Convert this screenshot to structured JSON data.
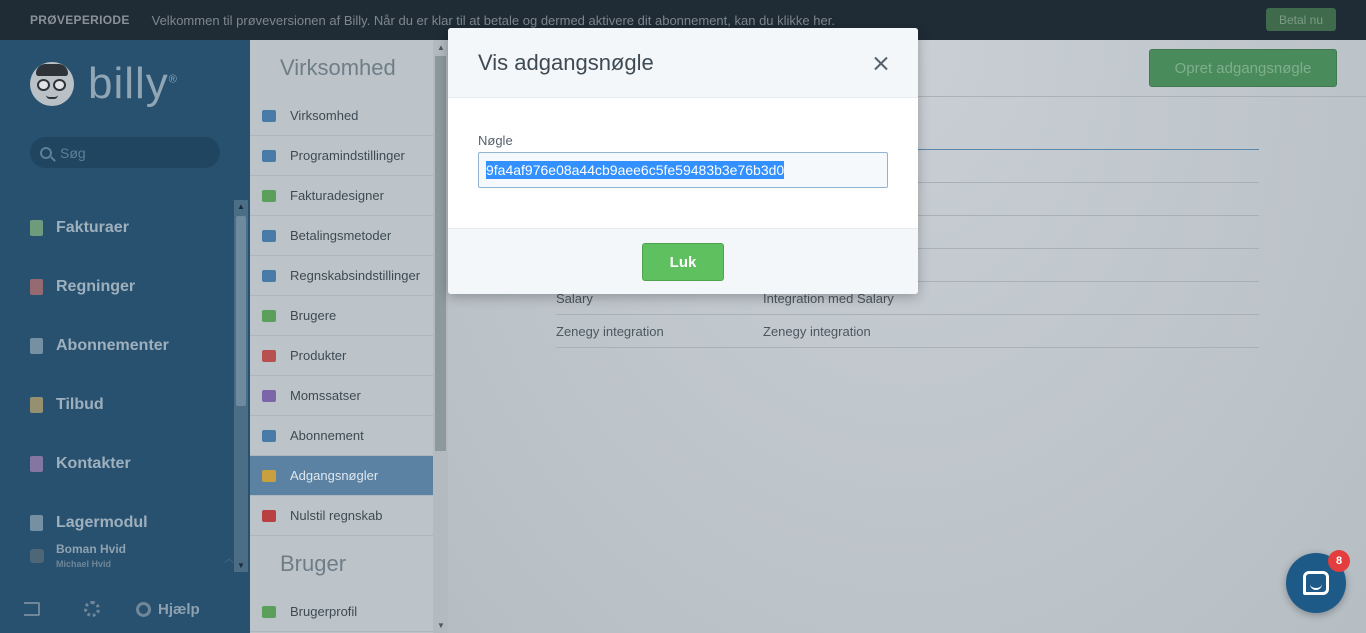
{
  "trial_bar": {
    "label": "PRØVEPERIODE",
    "text": "Velkommen til prøveversionen af Billy. Når du er klar til at betale og dermed aktivere dit abonnement, kan du klikke her.",
    "pay_button": "Betal nu"
  },
  "sidebar": {
    "logo_text": "billy",
    "logo_mark": "®",
    "search_placeholder": "Søg",
    "items": [
      {
        "label": "Fakturaer",
        "icon": "invoice-icon",
        "color": "#7fae7f"
      },
      {
        "label": "Regninger",
        "icon": "bill-icon",
        "color": "#b07070"
      },
      {
        "label": "Abonnementer",
        "icon": "subscription-icon",
        "color": "#8aa0b0"
      },
      {
        "label": "Tilbud",
        "icon": "quote-icon",
        "color": "#b0a070"
      },
      {
        "label": "Kontakter",
        "icon": "contacts-icon",
        "color": "#9a80b0"
      },
      {
        "label": "Lagermodul",
        "icon": "inventory-icon",
        "color": "#8aa0b0"
      }
    ],
    "user_name": "Boman Hvid",
    "user_sub": "Michael Hvid",
    "help_label": "Hjælp"
  },
  "submenu": {
    "heading": "Virksomhed",
    "items": [
      {
        "label": "Virksomhed",
        "icon": "company-icon",
        "color": "#4a7ba8"
      },
      {
        "label": "Programindstillinger",
        "icon": "gear-icon",
        "color": "#4a7ba8"
      },
      {
        "label": "Fakturadesigner",
        "icon": "designer-icon",
        "color": "#5aa05a"
      },
      {
        "label": "Betalingsmetoder",
        "icon": "card-icon",
        "color": "#4a7ba8"
      },
      {
        "label": "Regnskabsindstillinger",
        "icon": "accounting-icon",
        "color": "#4a7ba8"
      },
      {
        "label": "Brugere",
        "icon": "users-icon",
        "color": "#5aa05a"
      },
      {
        "label": "Produkter",
        "icon": "products-icon",
        "color": "#b85050"
      },
      {
        "label": "Momssatser",
        "icon": "vat-icon",
        "color": "#7a66a8"
      },
      {
        "label": "Abonnement",
        "icon": "subscription-icon",
        "color": "#4a7ba8"
      },
      {
        "label": "Adgangsnøgler",
        "icon": "key-icon",
        "color": "#c8a040",
        "active": true
      },
      {
        "label": "Nulstil regnskab",
        "icon": "reset-icon",
        "color": "#b84040"
      }
    ],
    "user_heading": "Bruger",
    "user_items": [
      {
        "label": "Brugerprofil",
        "icon": "profile-icon",
        "color": "#5aa05a"
      }
    ]
  },
  "main": {
    "create_button": "Opret adgangsnøgle",
    "rows": [
      {
        "name": "Salary",
        "description": "Integration med Salary"
      },
      {
        "name": "Zenegy integration",
        "description": "Zenegy integration"
      }
    ]
  },
  "modal": {
    "title": "Vis adgangsnøgle",
    "field_label": "Nøgle",
    "key_value": "9fa4af976e08a44cb9aee6c5fe59483b3e76b3d0",
    "close_button": "Luk"
  },
  "chat": {
    "badge_count": "8"
  }
}
